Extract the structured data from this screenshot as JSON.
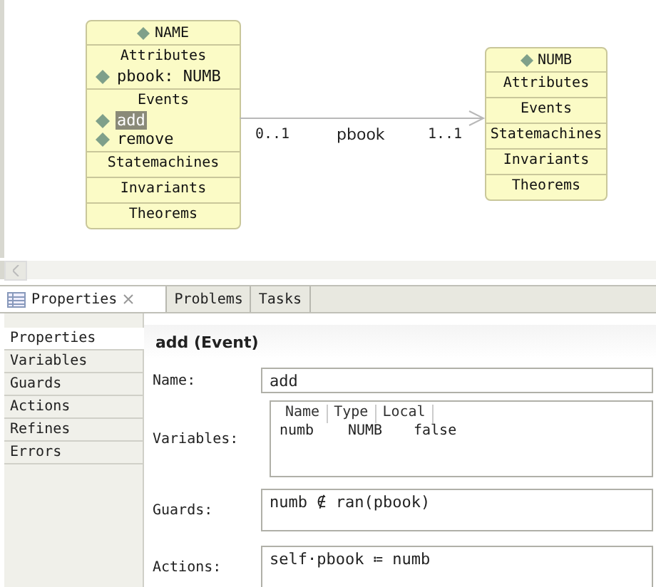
{
  "diagram": {
    "classes": [
      {
        "name": "NAME",
        "sections": [
          {
            "title": "Attributes",
            "items": [
              {
                "label": "pbook: NUMB",
                "selected": false
              }
            ]
          },
          {
            "title": "Events",
            "items": [
              {
                "label": "add",
                "selected": true
              },
              {
                "label": "remove",
                "selected": false
              }
            ]
          },
          {
            "title": "Statemachines"
          },
          {
            "title": "Invariants"
          },
          {
            "title": "Theorems"
          }
        ]
      },
      {
        "name": "NUMB",
        "sections": [
          {
            "title": "Attributes"
          },
          {
            "title": "Events"
          },
          {
            "title": "Statemachines"
          },
          {
            "title": "Invariants"
          },
          {
            "title": "Theorems"
          }
        ]
      }
    ],
    "association": {
      "source_multiplicity": "0..1",
      "name": "pbook",
      "target_multiplicity": "1..1"
    }
  },
  "tabs": [
    {
      "label": "Properties",
      "selected": true,
      "closable": true
    },
    {
      "label": "Problems",
      "selected": false,
      "closable": false
    },
    {
      "label": "Tasks",
      "selected": false,
      "closable": false
    }
  ],
  "side_tabs": [
    {
      "label": "Properties",
      "selected": true
    },
    {
      "label": "Variables",
      "selected": false
    },
    {
      "label": "Guards",
      "selected": false
    },
    {
      "label": "Actions",
      "selected": false
    },
    {
      "label": "Refines",
      "selected": false
    },
    {
      "label": "Errors",
      "selected": false
    }
  ],
  "header": "add (Event)",
  "form": {
    "name": {
      "label": "Name:",
      "value": "add"
    },
    "variables": {
      "label": "Variables:",
      "columns": [
        "Name",
        "Type",
        "Local"
      ],
      "rows": [
        [
          "numb",
          "NUMB",
          "false"
        ]
      ]
    },
    "guards": {
      "label": "Guards:",
      "value": "numb ∉ ran(pbook)"
    },
    "actions": {
      "label": "Actions:",
      "value": "self·pbook ≔ numb"
    }
  }
}
